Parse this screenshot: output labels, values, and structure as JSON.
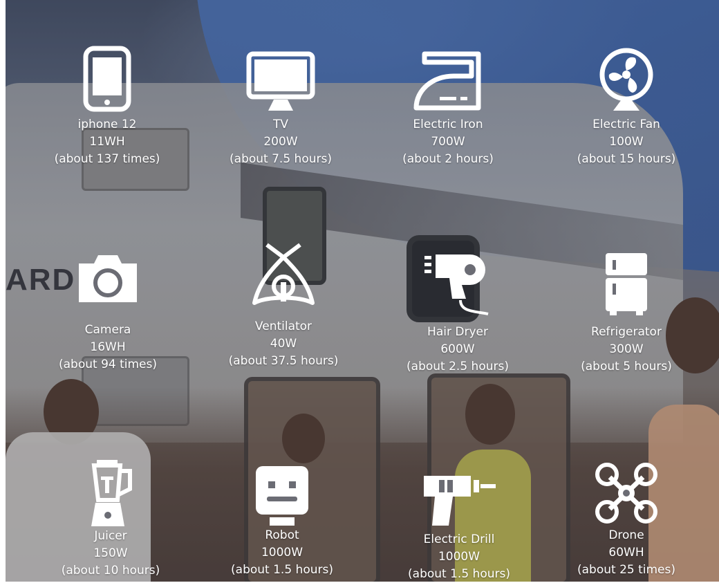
{
  "appliances": [
    {
      "name": "iphone 12",
      "power": "11WH",
      "runtime": "(about 137 times)",
      "icon": "smartphone-icon"
    },
    {
      "name": "TV",
      "power": "200W",
      "runtime": "(about 7.5 hours)",
      "icon": "tv-icon"
    },
    {
      "name": "Electric Iron",
      "power": "700W",
      "runtime": "(about 2 hours)",
      "icon": "iron-icon"
    },
    {
      "name": "Electric Fan",
      "power": "100W",
      "runtime": "(about 15 hours)",
      "icon": "fan-icon"
    },
    {
      "name": "Camera",
      "power": "16WH",
      "runtime": "(about 94 times)",
      "icon": "camera-icon"
    },
    {
      "name": "Ventilator",
      "power": "40W",
      "runtime": "(about 37.5 hours)",
      "icon": "ventilator-icon"
    },
    {
      "name": "Hair Dryer",
      "power": "600W",
      "runtime": "(about 2.5 hours)",
      "icon": "hair-dryer-icon"
    },
    {
      "name": "Refrigerator",
      "power": "300W",
      "runtime": "(about 5 hours)",
      "icon": "refrigerator-icon"
    },
    {
      "name": "Juicer",
      "power": "150W",
      "runtime": "(about 10 hours)",
      "icon": "blender-icon"
    },
    {
      "name": "Robot",
      "power": "1000W",
      "runtime": "(about 1.5 hours)",
      "icon": "robot-icon"
    },
    {
      "name": "Electric Drill",
      "power": "1000W",
      "runtime": "(about 1.5 hours)",
      "icon": "drill-icon"
    },
    {
      "name": "Drone",
      "power": "60WH",
      "runtime": "(about 25 times)",
      "icon": "drone-icon"
    }
  ],
  "background": {
    "trailer_lettering": "ARD",
    "chair_logo_text": ""
  }
}
